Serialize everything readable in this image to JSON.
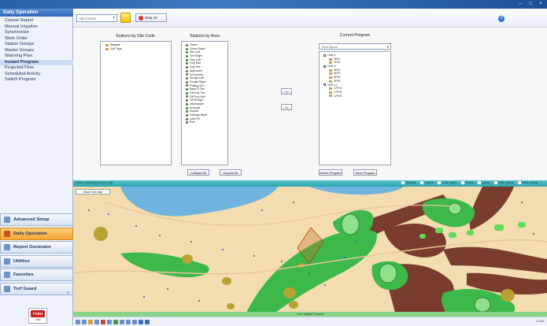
{
  "sidebar": {
    "header": "Daily Operation",
    "items": [
      {
        "label": "Course Report"
      },
      {
        "label": "Manual Irrigation"
      },
      {
        "label": "Synchronize"
      },
      {
        "label": "Work Order"
      },
      {
        "label": "Station Groups"
      },
      {
        "label": "Master Groups"
      },
      {
        "label": "Watering Plan"
      },
      {
        "label": "Instant Program",
        "active": true
      },
      {
        "label": "Projected Flow"
      },
      {
        "label": "Scheduled Activity"
      },
      {
        "label": "Switch Program"
      }
    ],
    "bars": [
      {
        "label": "Advanced Setup",
        "icon": "setup-icon"
      },
      {
        "label": "Daily Operation",
        "icon": "daily-operation-icon",
        "active": true
      },
      {
        "label": "Report Generator",
        "icon": "report-icon"
      },
      {
        "label": "Utilities",
        "icon": "utilities-icon"
      },
      {
        "label": "Favorites",
        "icon": "favorites-icon"
      },
      {
        "label": "Turf Guard",
        "icon": "turf-guard-icon"
      }
    ],
    "logo": {
      "text": "TORO",
      "sub": "VAN"
    }
  },
  "toolbar": {
    "course": "My Course",
    "stop_label": "Stop All"
  },
  "program": {
    "site_title": "Stations by Site Code",
    "site_items": [
      "Bayside",
      "Soil Type"
    ],
    "area_title": "Stations by Area",
    "area_items": [
      "Green",
      "Green Back",
      "Tee Left",
      "Tee Right",
      "Fwy Left",
      "Fwy Mid",
      "Fwy Tee",
      "Approach",
      "Surrounds",
      "Rough Left",
      "Rough Right",
      "Putting Grn",
      "Back R Tee",
      "Off Fwy Tee",
      "Off Fwy Mid",
      "Off Rough",
      "Landscape",
      "Annuals",
      "Zoysia",
      "Fairway Back",
      "Lake Rt",
      "Pub"
    ],
    "current_title": "Current Program",
    "current_select": "Fwd Syncs",
    "current_tree": [
      "Hole 1",
      "1F01",
      "1F04",
      "Hole 4",
      "4F01",
      "4F03",
      "4F05",
      "4F06",
      "Hole 17",
      "17F01",
      "17F02",
      "17F03"
    ],
    "add_label": ">>",
    "remove_label": "<<",
    "collapse_label": "Collapse All",
    "expand_label": "Expand All",
    "delete_label": "Delete Program",
    "save_label": "Save Program"
  },
  "map": {
    "header_text": "Select stations then from map",
    "show_label": "Show Live Map",
    "layers": [
      "Stations",
      "Legend",
      "Hole Layers",
      "Roads",
      "Labels",
      "Hole Labels",
      "Pass Zoning"
    ],
    "status": "Live Station Paused",
    "coord": "1:1007"
  },
  "colors": {
    "header_teal": "#2ba4ad",
    "sand": "#f2dcb0",
    "fairway": "#3db84a",
    "green": "#8fe08a",
    "rough": "#7a3c2c",
    "water": "#6fb3de",
    "shrub": "#b9a232",
    "status_green": "#8ad18a"
  },
  "chart_data": {}
}
